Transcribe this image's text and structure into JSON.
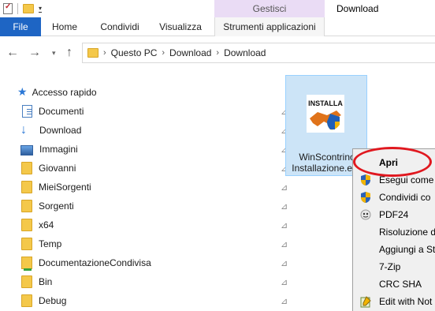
{
  "titlebar": {
    "qat_icons": [
      "properties-icon",
      "new-folder-icon",
      "customize-dropdown-icon"
    ],
    "context_tab_group": "Gestisci",
    "window_title": "Download"
  },
  "ribbon": {
    "tabs": [
      {
        "label": "File"
      },
      {
        "label": "Home"
      },
      {
        "label": "Condividi"
      },
      {
        "label": "Visualizza"
      },
      {
        "label": "Strumenti applicazioni"
      }
    ]
  },
  "address": {
    "crumbs": [
      "Questo PC",
      "Download",
      "Download"
    ]
  },
  "sidebar": {
    "quick_access": "Accesso rapido",
    "items": [
      {
        "label": "Documenti",
        "icon": "documents-icon"
      },
      {
        "label": "Download",
        "icon": "download-icon"
      },
      {
        "label": "Immagini",
        "icon": "pictures-icon"
      },
      {
        "label": "Giovanni",
        "icon": "folder-icon"
      },
      {
        "label": "MieiSorgenti",
        "icon": "folder-icon"
      },
      {
        "label": "Sorgenti",
        "icon": "folder-icon"
      },
      {
        "label": "x64",
        "icon": "folder-icon"
      },
      {
        "label": "Temp",
        "icon": "folder-icon"
      },
      {
        "label": "DocumentazioneCondivisa",
        "icon": "shared-folder-icon"
      },
      {
        "label": "Bin",
        "icon": "folder-icon"
      },
      {
        "label": "Debug",
        "icon": "folder-icon"
      }
    ]
  },
  "file": {
    "icon_text": "INSTALLA",
    "name_line1": "WinScontrino",
    "name_line2": "Installazione.exe"
  },
  "context_menu": {
    "items": [
      {
        "label": "Apri",
        "icon": ""
      },
      {
        "label": "Esegui come",
        "icon": "uac-shield-icon"
      },
      {
        "label": "Condividi co",
        "icon": "uac-shield-icon"
      },
      {
        "label": "PDF24",
        "icon": "pdf24-icon"
      },
      {
        "label": "Risoluzione d",
        "icon": ""
      },
      {
        "label": "Aggiungi a St",
        "icon": ""
      },
      {
        "label": "7-Zip",
        "icon": ""
      },
      {
        "label": "CRC SHA",
        "icon": ""
      },
      {
        "label": "Edit with Not",
        "icon": "notepad-icon"
      }
    ]
  },
  "colors": {
    "accent": "#1e65c4",
    "context_tab": "#eadcf5",
    "selection": "#cce4f7",
    "annotation": "#e0181f"
  }
}
